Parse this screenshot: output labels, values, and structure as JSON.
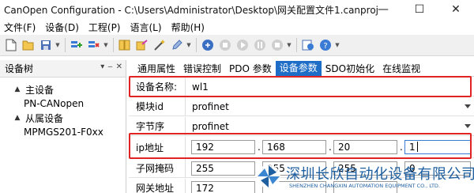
{
  "window": {
    "title": "CanOpen Configuration - C:\\Users\\Administrator\\Desktop\\网关配置文件1.canproj",
    "minimize_glyph": "—",
    "maximize_glyph": "☐",
    "close_glyph": "✕"
  },
  "menu": [
    {
      "label": "文件(F)"
    },
    {
      "label": "设备(D)"
    },
    {
      "label": "工程(P)"
    },
    {
      "label": "语言(L)"
    },
    {
      "label": "帮助(H)"
    }
  ],
  "left_panel": {
    "title": "设备树",
    "tree": [
      {
        "label": "主设备",
        "arrow": "▲",
        "level": 0
      },
      {
        "label": "PN-CANopen",
        "arrow": "",
        "level": 1
      },
      {
        "label": "从属设备",
        "arrow": "▲",
        "level": 0
      },
      {
        "label": "MPMGS201-F0xx",
        "arrow": "",
        "level": 1
      }
    ],
    "buttons": [
      "▾",
      "‒",
      "✕"
    ]
  },
  "tabs": [
    {
      "label": "通用属性",
      "active": false
    },
    {
      "label": "错误控制",
      "active": false
    },
    {
      "label": "PDO 参数",
      "active": false
    },
    {
      "label": "设备参数",
      "active": true
    },
    {
      "label": "SDO初始化",
      "active": false
    },
    {
      "label": "在线监视",
      "active": false
    }
  ],
  "params": {
    "device_name": {
      "label": "设备名称:",
      "value": "wl1"
    },
    "module_id": {
      "label": "模块id",
      "value": "profinet"
    },
    "byte_order": {
      "label": "字节序",
      "value": "profinet"
    },
    "ip": {
      "label": "ip地址",
      "octets": [
        "192",
        "168",
        "20",
        "1"
      ]
    },
    "subnet": {
      "label": "子网掩码",
      "octets": [
        "255",
        "255",
        "255",
        "0"
      ]
    },
    "gateway": {
      "label": "网关地址",
      "octets": [
        "172",
        "",
        "",
        ""
      ]
    }
  },
  "watermark": {
    "company_cn": "深圳长欣自动化设备有限公司",
    "company_en": "SHENZHEN CHANGXIN AUTOMATION EQUIPMENT CO., LTD."
  },
  "colors": {
    "accent": "#1e6ec8",
    "highlight": "#e02424",
    "brand": "#1e5fa0"
  }
}
